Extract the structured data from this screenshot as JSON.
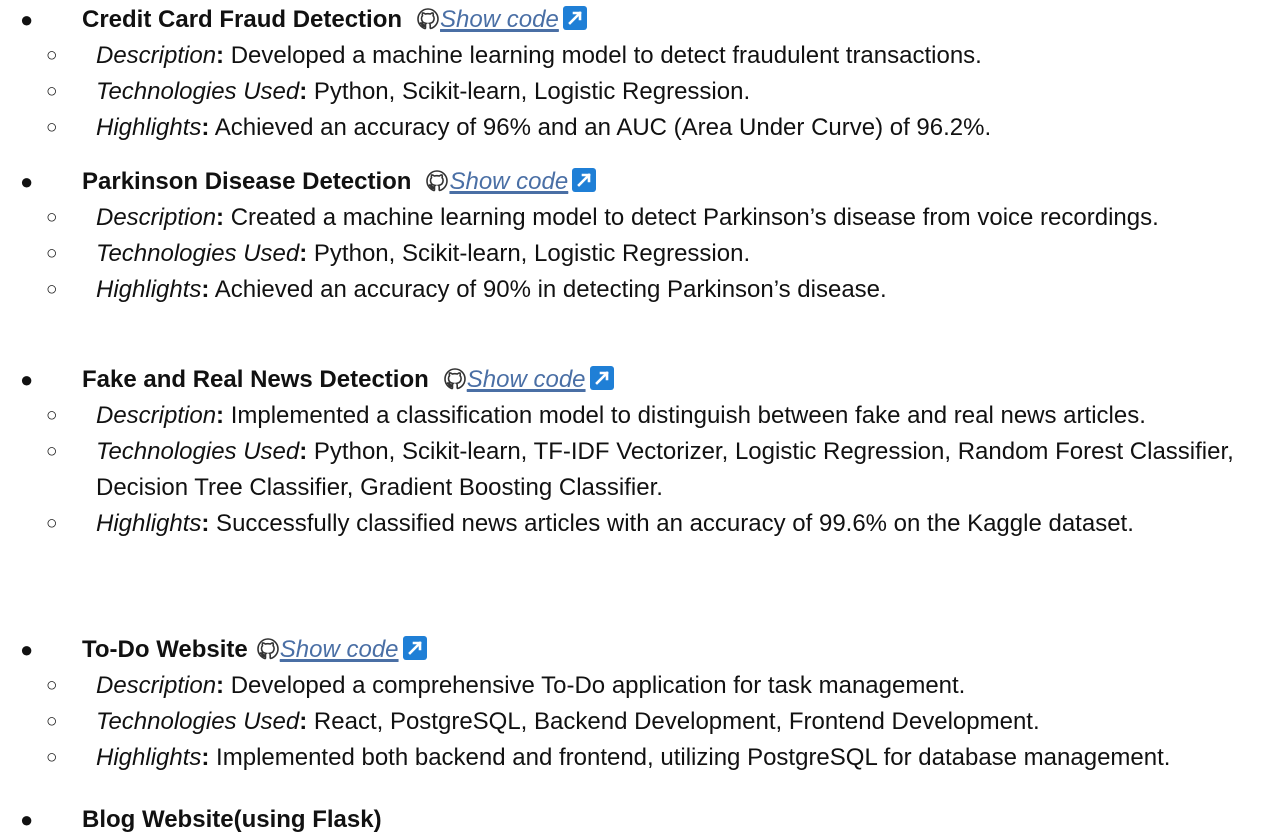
{
  "projects": [
    {
      "title": "Credit Card Fraud Detection",
      "link_label": "Show code",
      "items": [
        {
          "label": "Description",
          "colon": ":",
          "text": " Developed a machine learning model to detect fraudulent transactions."
        },
        {
          "label": "Technologies Used",
          "colon": ":",
          "text": " Python, Scikit-learn, Logistic Regression."
        },
        {
          "label": "Highlights",
          "colon": ":",
          "text": " Achieved an accuracy of 96% and an AUC (Area Under Curve) of 96.2%."
        }
      ]
    },
    {
      "title": "Parkinson Disease Detection",
      "link_label": "Show code",
      "items": [
        {
          "label": "Description",
          "colon": ":",
          "text": " Created a machine learning model to detect Parkinson’s disease from voice recordings."
        },
        {
          "label": "Technologies Used",
          "colon": ":",
          "text": " Python, Scikit-learn, Logistic Regression."
        },
        {
          "label": "Highlights",
          "colon": ":",
          "text": " Achieved an accuracy of 90% in detecting Parkinson’s disease."
        }
      ]
    },
    {
      "title": "Fake and Real News Detection",
      "link_label": "Show code",
      "items": [
        {
          "label": "Description",
          "colon": ":",
          "text": " Implemented a classification model to distinguish between fake and real news articles."
        },
        {
          "label": "Technologies Used",
          "colon": ":",
          "text": " Python, Scikit-learn, TF-IDF Vectorizer, Logistic Regression, Random Forest Classifier, Decision Tree Classifier, Gradient Boosting Classifier."
        },
        {
          "label": "Highlights",
          "colon": ":",
          "text": " Successfully classified news articles with an accuracy of 99.6% on the Kaggle dataset."
        }
      ]
    },
    {
      "title": "To-Do Website",
      "link_label": "Show code",
      "items": [
        {
          "label": "Description",
          "colon": ":",
          "text": " Developed a comprehensive To-Do application for task management."
        },
        {
          "label": "Technologies Used",
          "colon": ":",
          "text": " React, PostgreSQL, Backend Development, Frontend Development."
        },
        {
          "label": "Highlights",
          "colon": ":",
          "text": " Implemented both backend and frontend, utilizing PostgreSQL for database management."
        }
      ]
    },
    {
      "title": "Blog Website(using Flask)",
      "link_label": "",
      "items": []
    }
  ],
  "icons": {
    "bullet": "●",
    "sub_bullet": "○",
    "github": "github-icon",
    "external": "external-link-icon"
  },
  "colors": {
    "link": "#4a6fa5",
    "external_badge": "#1f7fd6",
    "text": "#111111"
  }
}
